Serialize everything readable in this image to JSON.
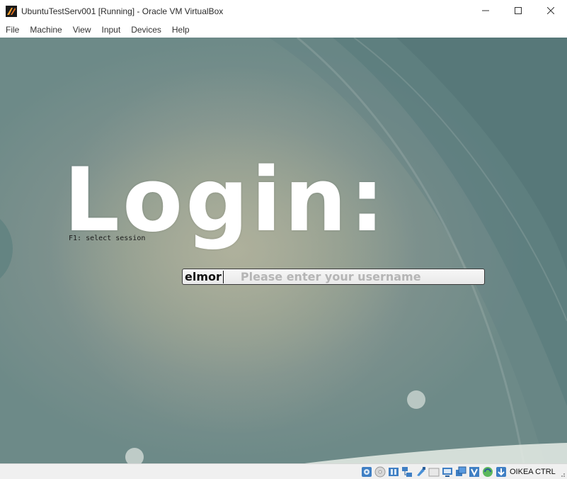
{
  "window": {
    "title": "UbuntuTestServ001 [Running] - Oracle VM VirtualBox",
    "app_icon": "virtualbox-icon",
    "controls": [
      "minimize-icon",
      "maximize-icon",
      "close-icon"
    ]
  },
  "menubar": {
    "items": [
      {
        "label": "File"
      },
      {
        "label": "Machine"
      },
      {
        "label": "View"
      },
      {
        "label": "Input"
      },
      {
        "label": "Devices"
      },
      {
        "label": "Help"
      }
    ]
  },
  "vm": {
    "login_title": "Login:",
    "session_hint": "F1: select session",
    "username": {
      "value": "elmor",
      "placeholder": "Please enter your username"
    }
  },
  "statusbar": {
    "icons": [
      "hard-disk-icon",
      "optical-drive-icon",
      "audio-icon",
      "network-icon",
      "usb-icon",
      "shared-folders-icon",
      "display-icon",
      "recording-icon",
      "cpu-icon",
      "mouse-integration-icon",
      "download-icon"
    ],
    "host_key": "OIKEA CTRL"
  },
  "colors": {
    "vm_background": "#7d918d",
    "login_text": "#ffffff",
    "placeholder": "#b5b5b5"
  }
}
